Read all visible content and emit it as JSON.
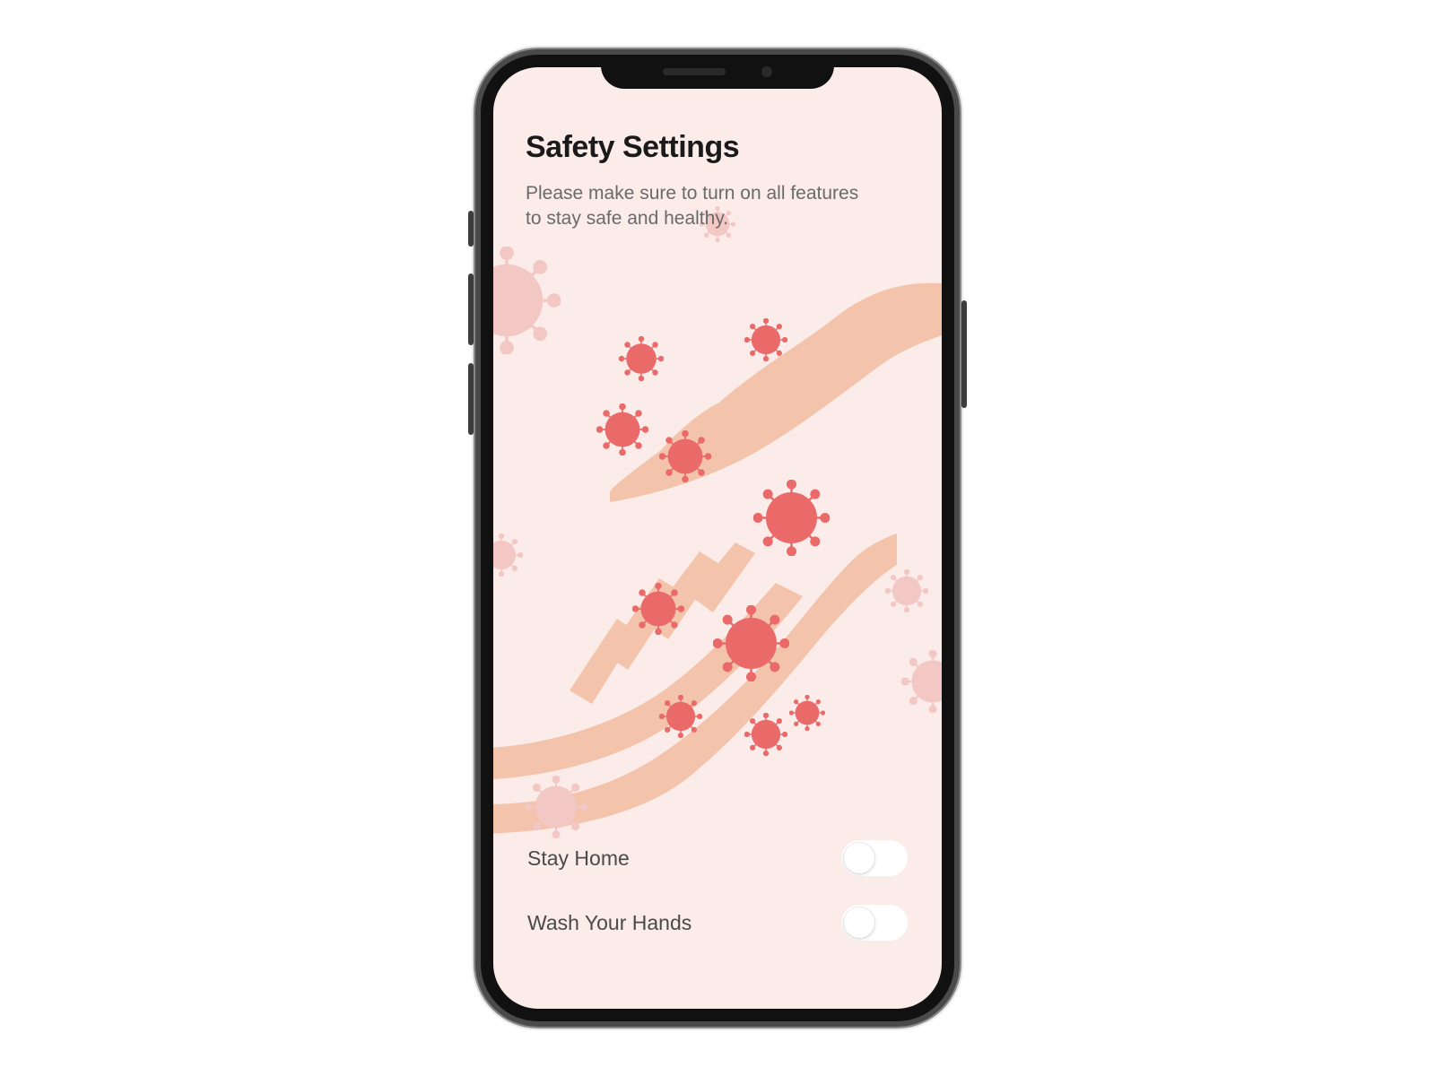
{
  "header": {
    "title": "Safety Settings",
    "subtitle": "Please make sure to turn on all features to stay safe and healthy."
  },
  "settings": [
    {
      "label": "Stay Home",
      "value": false
    },
    {
      "label": "Wash Your Hands",
      "value": false
    }
  ],
  "colors": {
    "screen_bg": "#fbecea",
    "virus_bright": "#ea6a6a",
    "virus_faded": "#f3c7c3",
    "hand": "#f3c4ab",
    "toggle_track": "#ffffff"
  },
  "icons": {
    "virus": "virus-icon",
    "hand": "hand-icon"
  }
}
